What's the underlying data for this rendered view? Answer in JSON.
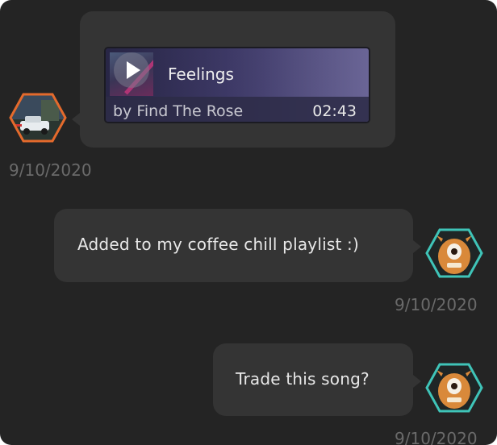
{
  "messages": [
    {
      "type": "song",
      "sender": "other",
      "song": {
        "title": "Feelings",
        "artist": "by Find The Rose",
        "duration": "02:43"
      },
      "timestamp": "9/10/2020",
      "avatar_icon": "car-avatar-icon"
    },
    {
      "type": "text",
      "sender": "me",
      "text": "Added to my coffee chill playlist :)",
      "timestamp": "9/10/2020",
      "avatar_icon": "monster-avatar-icon"
    },
    {
      "type": "text",
      "sender": "me",
      "text": "Trade this song?",
      "timestamp": "9/10/2020",
      "avatar_icon": "monster-avatar-icon"
    }
  ],
  "colors": {
    "background": "#242424",
    "bubble": "#343434",
    "other_avatar_border": "#e46a2c",
    "my_avatar_border": "#3fc4b8",
    "timestamp": "#6a6a6a",
    "text": "#e8e8e8"
  }
}
